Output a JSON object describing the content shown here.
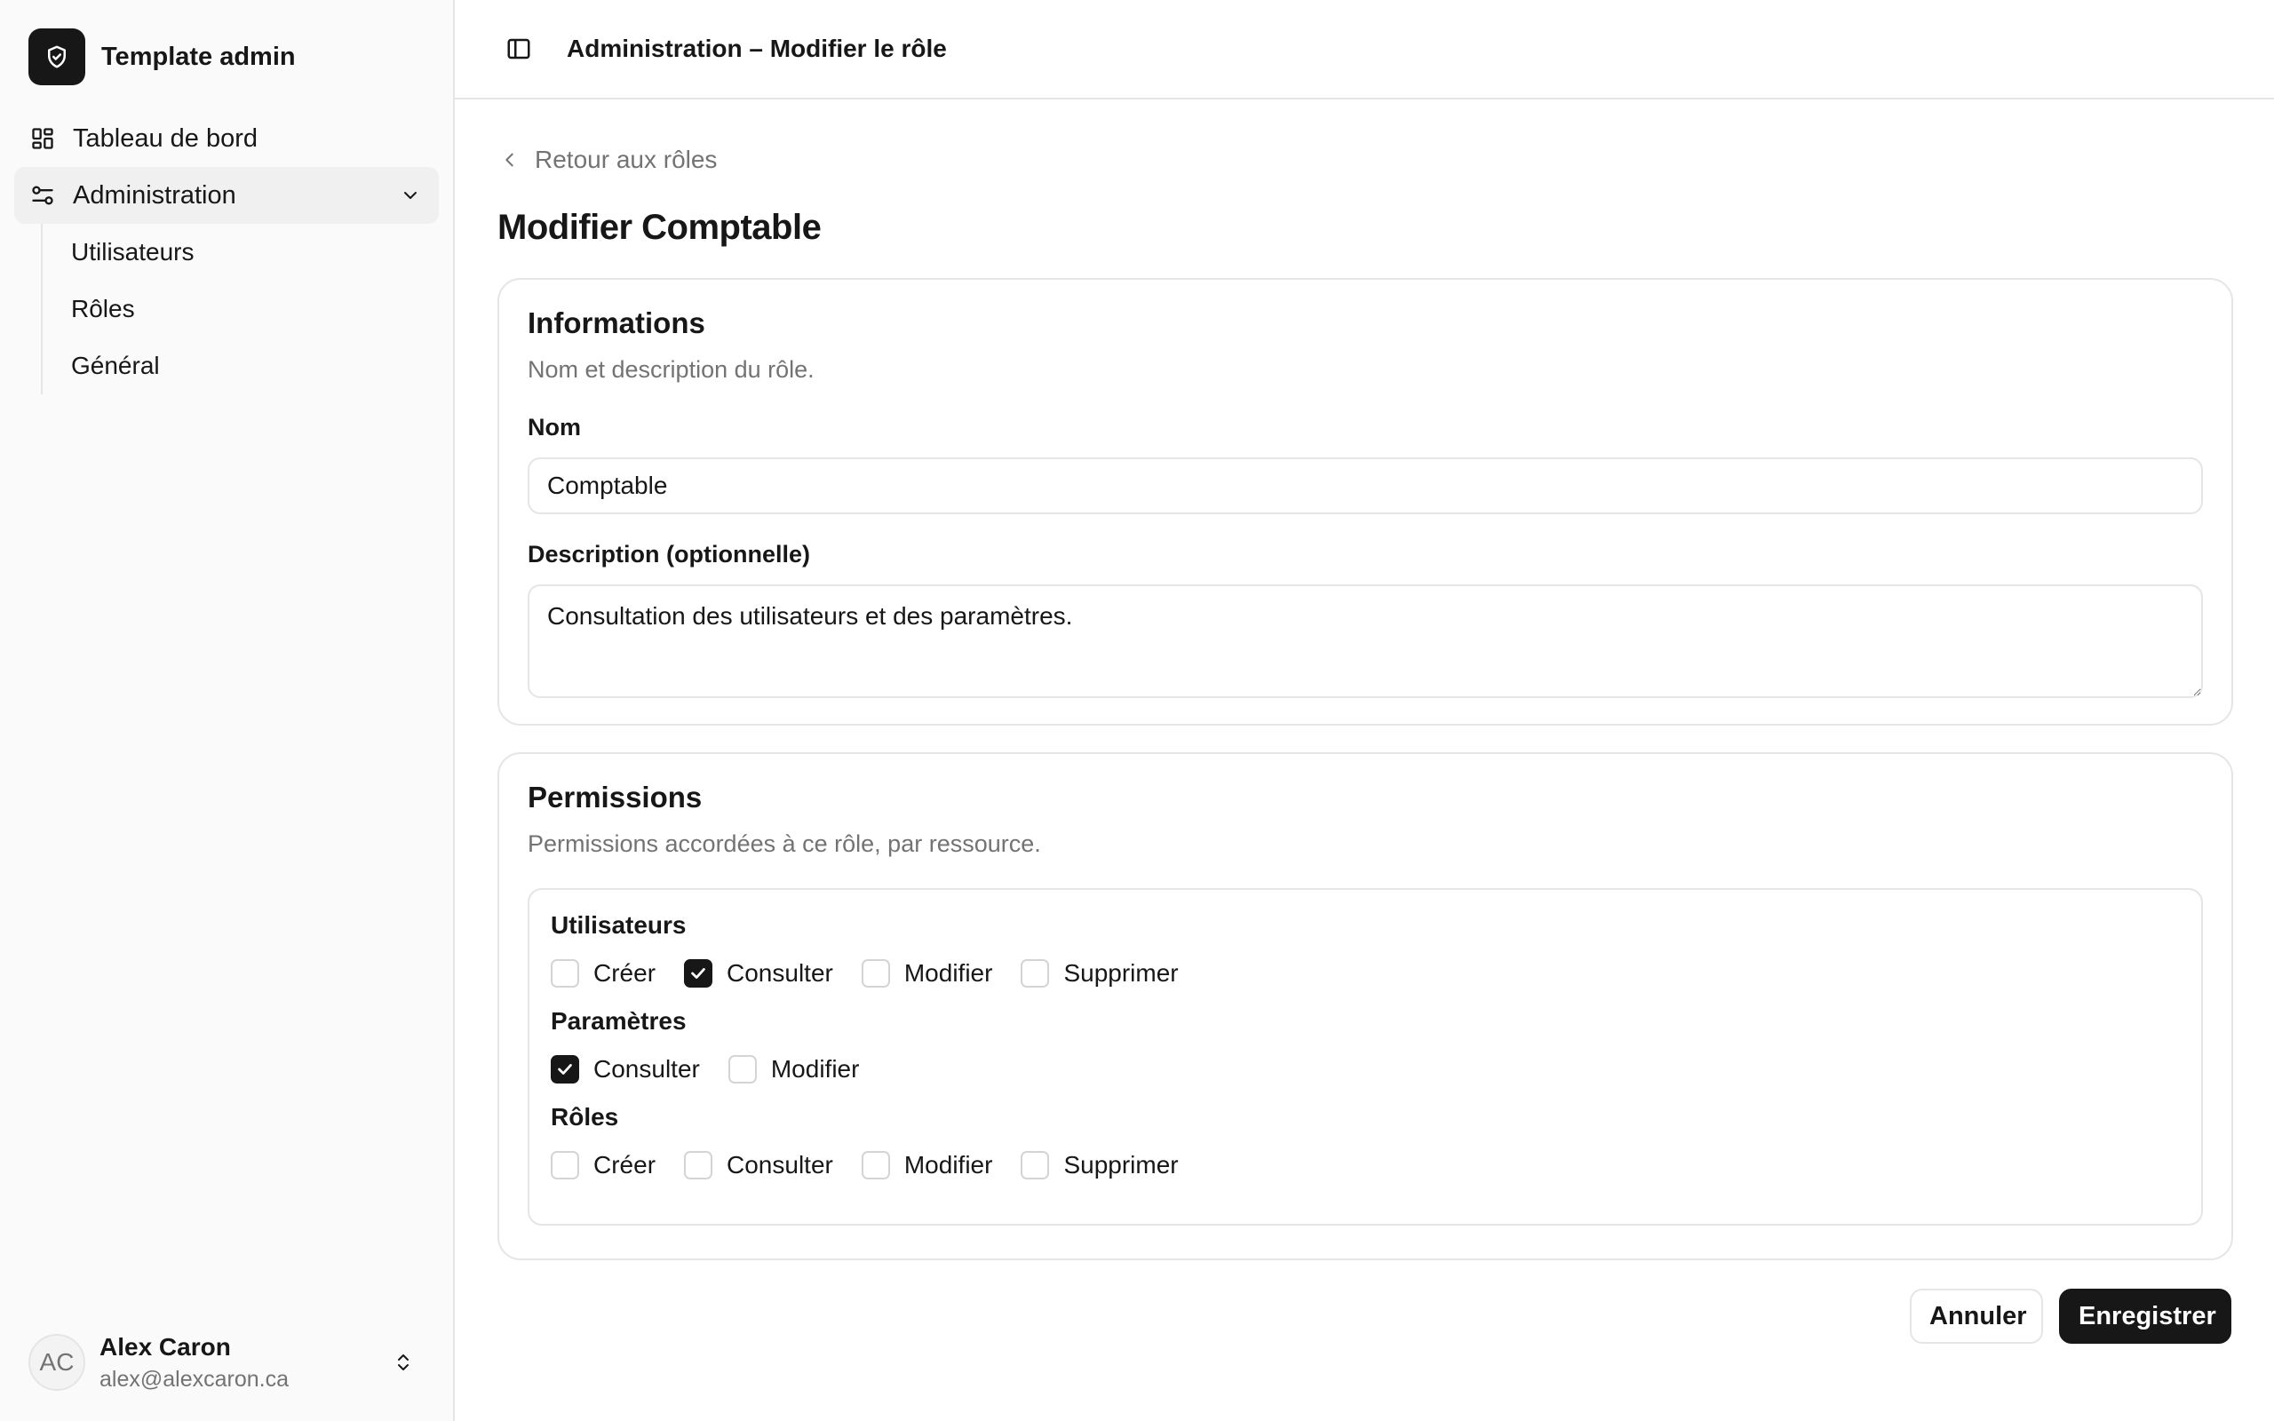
{
  "brand": {
    "name": "Template admin",
    "logo_icon": "shield-check-icon"
  },
  "sidebar": {
    "items": [
      {
        "label": "Tableau de bord",
        "icon": "dashboard-icon"
      },
      {
        "label": "Administration",
        "icon": "sliders-icon",
        "expanded": true
      }
    ],
    "subitems": [
      "Utilisateurs",
      "Rôles",
      "Général"
    ]
  },
  "user": {
    "initials": "AC",
    "name": "Alex Caron",
    "email": "alex@alexcaron.ca"
  },
  "topbar": {
    "title": "Administration – Modifier le rôle"
  },
  "back_link": "Retour aux rôles",
  "page_title": "Modifier Comptable",
  "info_card": {
    "title": "Informations",
    "description": "Nom et description du rôle.",
    "name_label": "Nom",
    "name_value": "Comptable",
    "desc_label": "Description (optionnelle)",
    "desc_value": "Consultation des utilisateurs et des paramètres."
  },
  "perm_card": {
    "title": "Permissions",
    "description": "Permissions accordées à ce rôle, par ressource.",
    "groups": [
      {
        "title": "Utilisateurs",
        "options": [
          {
            "label": "Créer",
            "checked": false
          },
          {
            "label": "Consulter",
            "checked": true
          },
          {
            "label": "Modifier",
            "checked": false
          },
          {
            "label": "Supprimer",
            "checked": false
          }
        ]
      },
      {
        "title": "Paramètres",
        "options": [
          {
            "label": "Consulter",
            "checked": true
          },
          {
            "label": "Modifier",
            "checked": false
          }
        ]
      },
      {
        "title": "Rôles",
        "options": [
          {
            "label": "Créer",
            "checked": false
          },
          {
            "label": "Consulter",
            "checked": false
          },
          {
            "label": "Modifier",
            "checked": false
          },
          {
            "label": "Supprimer",
            "checked": false
          }
        ]
      }
    ]
  },
  "actions": {
    "cancel": "Annuler",
    "save": "Enregistrer"
  },
  "colors": {
    "primary": "#171717",
    "muted": "#737373",
    "border": "#e5e5e5",
    "sidebar_bg": "#fafafa"
  }
}
